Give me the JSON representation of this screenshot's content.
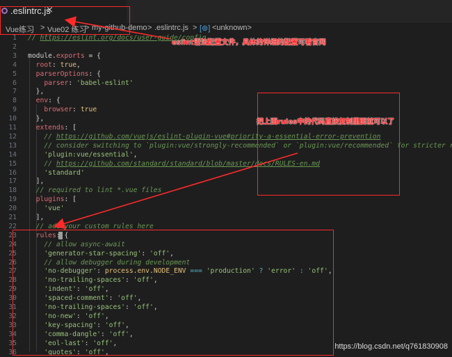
{
  "tab": {
    "filename": ".eslintrc.js",
    "close": "×"
  },
  "breadcrumb": {
    "items": [
      "Vue练习",
      ">",
      "Vue02 练习",
      ">",
      "my-github-demo",
      ">",
      ".eslintrc.js",
      ">",
      "<unknown>"
    ]
  },
  "code_lines": [
    {
      "n": "1",
      "tokens": [
        {
          "t": "// ",
          "c": "comment"
        },
        {
          "t": "https://eslint.org/docs/user-guide/config",
          "c": "url"
        }
      ]
    },
    {
      "n": "2",
      "tokens": []
    },
    {
      "n": "3",
      "tokens": [
        {
          "t": "module.",
          "c": "punc"
        },
        {
          "t": "exports",
          "c": "key"
        },
        {
          "t": " = {",
          "c": "punc"
        }
      ]
    },
    {
      "n": "4",
      "tokens": [
        {
          "t": "  root",
          "c": "key"
        },
        {
          "t": ": ",
          "c": "punc"
        },
        {
          "t": "true",
          "c": "bool"
        },
        {
          "t": ",",
          "c": "punc"
        }
      ]
    },
    {
      "n": "5",
      "tokens": [
        {
          "t": "  parserOptions",
          "c": "key"
        },
        {
          "t": ": {",
          "c": "punc"
        }
      ]
    },
    {
      "n": "6",
      "tokens": [
        {
          "t": "    parser",
          "c": "key"
        },
        {
          "t": ": ",
          "c": "punc"
        },
        {
          "t": "'babel-eslint'",
          "c": "str"
        }
      ]
    },
    {
      "n": "7",
      "tokens": [
        {
          "t": "  },",
          "c": "punc"
        }
      ]
    },
    {
      "n": "8",
      "tokens": [
        {
          "t": "  env",
          "c": "key"
        },
        {
          "t": ": {",
          "c": "punc"
        }
      ]
    },
    {
      "n": "9",
      "tokens": [
        {
          "t": "    browser",
          "c": "key"
        },
        {
          "t": ": ",
          "c": "punc"
        },
        {
          "t": "true",
          "c": "bool"
        }
      ]
    },
    {
      "n": "10",
      "tokens": [
        {
          "t": "  },",
          "c": "punc"
        }
      ]
    },
    {
      "n": "11",
      "tokens": [
        {
          "t": "  extends",
          "c": "key"
        },
        {
          "t": ": [",
          "c": "punc"
        }
      ]
    },
    {
      "n": "12",
      "tokens": [
        {
          "t": "    // ",
          "c": "comment"
        },
        {
          "t": "https://github.com/vuejs/eslint-plugin-vue#priority-a-essential-error-prevention",
          "c": "url"
        }
      ]
    },
    {
      "n": "13",
      "tokens": [
        {
          "t": "    // consider switching to `plugin:vue/strongly-recommended` or `plugin:vue/recommended` for stricter rules.",
          "c": "comment"
        }
      ]
    },
    {
      "n": "14",
      "tokens": [
        {
          "t": "    ",
          "c": "punc"
        },
        {
          "t": "'plugin:vue/essential'",
          "c": "str"
        },
        {
          "t": ",",
          "c": "punc"
        }
      ]
    },
    {
      "n": "15",
      "tokens": [
        {
          "t": "    // ",
          "c": "comment"
        },
        {
          "t": "https://github.com/standard/standard/blob/master/docs/RULES-en.md",
          "c": "url"
        }
      ]
    },
    {
      "n": "16",
      "tokens": [
        {
          "t": "    ",
          "c": "punc"
        },
        {
          "t": "'standard'",
          "c": "str"
        }
      ]
    },
    {
      "n": "17",
      "tokens": [
        {
          "t": "  ],",
          "c": "punc"
        }
      ]
    },
    {
      "n": "18",
      "tokens": [
        {
          "t": "  // required to lint *.vue files",
          "c": "comment"
        }
      ]
    },
    {
      "n": "19",
      "tokens": [
        {
          "t": "  plugins",
          "c": "key"
        },
        {
          "t": ": [",
          "c": "punc"
        }
      ]
    },
    {
      "n": "20",
      "tokens": [
        {
          "t": "    ",
          "c": "punc"
        },
        {
          "t": "'vue'",
          "c": "str"
        }
      ]
    },
    {
      "n": "21",
      "tokens": [
        {
          "t": "  ],",
          "c": "punc"
        }
      ]
    },
    {
      "n": "22",
      "tokens": [
        {
          "t": "  // add your custom rules here",
          "c": "comment"
        }
      ]
    },
    {
      "n": "23",
      "tokens": [
        {
          "t": "  rules",
          "c": "key"
        },
        {
          "t": ": {",
          "c": "punc"
        }
      ]
    },
    {
      "n": "24",
      "tokens": [
        {
          "t": "    // allow async-await",
          "c": "comment"
        }
      ]
    },
    {
      "n": "25",
      "tokens": [
        {
          "t": "    ",
          "c": "punc"
        },
        {
          "t": "'generator-star-spacing'",
          "c": "str"
        },
        {
          "t": ": ",
          "c": "punc"
        },
        {
          "t": "'off'",
          "c": "str"
        },
        {
          "t": ",",
          "c": "punc"
        }
      ]
    },
    {
      "n": "26",
      "tokens": [
        {
          "t": "    // allow debugger during development",
          "c": "comment"
        }
      ]
    },
    {
      "n": "27",
      "tokens": [
        {
          "t": "    ",
          "c": "punc"
        },
        {
          "t": "'no-debugger'",
          "c": "str"
        },
        {
          "t": ": ",
          "c": "punc"
        },
        {
          "t": "process",
          "c": "obj"
        },
        {
          "t": ".",
          "c": "punc"
        },
        {
          "t": "env",
          "c": "obj"
        },
        {
          "t": ".",
          "c": "punc"
        },
        {
          "t": "NODE_ENV",
          "c": "obj"
        },
        {
          "t": " === ",
          "c": "op"
        },
        {
          "t": "'production'",
          "c": "str"
        },
        {
          "t": " ? ",
          "c": "op"
        },
        {
          "t": "'error'",
          "c": "str"
        },
        {
          "t": " : ",
          "c": "op"
        },
        {
          "t": "'off'",
          "c": "str"
        },
        {
          "t": ",",
          "c": "punc"
        }
      ]
    },
    {
      "n": "28",
      "tokens": [
        {
          "t": "    ",
          "c": "punc"
        },
        {
          "t": "'no-trailing-spaces'",
          "c": "str"
        },
        {
          "t": ": ",
          "c": "punc"
        },
        {
          "t": "'off'",
          "c": "str"
        },
        {
          "t": ",",
          "c": "punc"
        }
      ]
    },
    {
      "n": "29",
      "tokens": [
        {
          "t": "    ",
          "c": "punc"
        },
        {
          "t": "'indent'",
          "c": "str"
        },
        {
          "t": ": ",
          "c": "punc"
        },
        {
          "t": "'off'",
          "c": "str"
        },
        {
          "t": ",",
          "c": "punc"
        }
      ]
    },
    {
      "n": "30",
      "tokens": [
        {
          "t": "    ",
          "c": "punc"
        },
        {
          "t": "'spaced-comment'",
          "c": "str"
        },
        {
          "t": ": ",
          "c": "punc"
        },
        {
          "t": "'off'",
          "c": "str"
        },
        {
          "t": ",",
          "c": "punc"
        }
      ]
    },
    {
      "n": "31",
      "tokens": [
        {
          "t": "    ",
          "c": "punc"
        },
        {
          "t": "'no-trailing-spaces'",
          "c": "str"
        },
        {
          "t": ": ",
          "c": "punc"
        },
        {
          "t": "'off'",
          "c": "str"
        },
        {
          "t": ",",
          "c": "punc"
        }
      ]
    },
    {
      "n": "32",
      "tokens": [
        {
          "t": "    ",
          "c": "punc"
        },
        {
          "t": "'no-new'",
          "c": "str"
        },
        {
          "t": ": ",
          "c": "punc"
        },
        {
          "t": "'off'",
          "c": "str"
        },
        {
          "t": ",",
          "c": "punc"
        }
      ]
    },
    {
      "n": "33",
      "tokens": [
        {
          "t": "    ",
          "c": "punc"
        },
        {
          "t": "'key-spacing'",
          "c": "str"
        },
        {
          "t": ": ",
          "c": "punc"
        },
        {
          "t": "'off'",
          "c": "str"
        },
        {
          "t": ",",
          "c": "punc"
        }
      ]
    },
    {
      "n": "34",
      "tokens": [
        {
          "t": "    ",
          "c": "punc"
        },
        {
          "t": "'comma-dangle'",
          "c": "str"
        },
        {
          "t": ": ",
          "c": "punc"
        },
        {
          "t": "'off'",
          "c": "str"
        },
        {
          "t": ",",
          "c": "punc"
        }
      ]
    },
    {
      "n": "35",
      "tokens": [
        {
          "t": "    ",
          "c": "punc"
        },
        {
          "t": "'eol-last'",
          "c": "str"
        },
        {
          "t": ": ",
          "c": "punc"
        },
        {
          "t": "'off'",
          "c": "str"
        },
        {
          "t": ",",
          "c": "punc"
        }
      ]
    },
    {
      "n": "36",
      "tokens": [
        {
          "t": "    ",
          "c": "punc"
        },
        {
          "t": "'quotes'",
          "c": "str"
        },
        {
          "t": ": ",
          "c": "punc"
        },
        {
          "t": "'off'",
          "c": "str"
        },
        {
          "t": ",",
          "c": "punc"
        }
      ]
    }
  ],
  "annotations": {
    "note1": "eslint语法配置文件，具体的详细的配置可看官网",
    "note2": "把上面rules中的代码直接复制里面就可以了"
  },
  "watermark": "https://blog.csdn.net/q761830908",
  "colors": {
    "background": "#1e1e1e",
    "annotation_red": "#ff2a2a",
    "keyword_red": "#e06c75",
    "string_green": "#98c379",
    "comment_green": "#6a9955"
  }
}
